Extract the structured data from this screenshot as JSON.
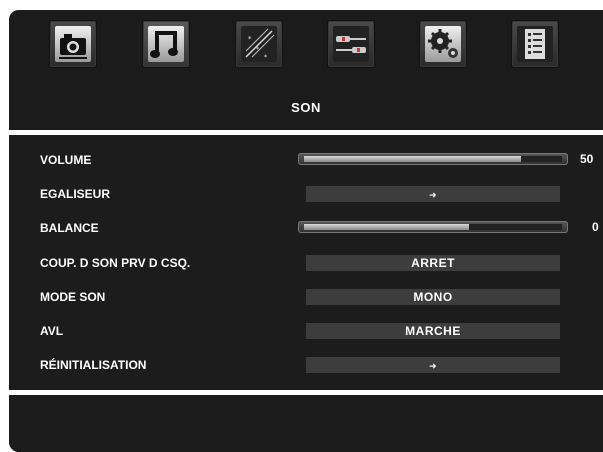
{
  "header": {
    "title": "SON",
    "icons": [
      {
        "name": "camera-icon",
        "active": false
      },
      {
        "name": "music-icon",
        "active": true
      },
      {
        "name": "stars-wand-icon",
        "active": false
      },
      {
        "name": "cable-connector-icon",
        "active": false
      },
      {
        "name": "gears-icon",
        "active": false
      },
      {
        "name": "document-icon",
        "active": false
      }
    ]
  },
  "menu": {
    "items": [
      {
        "label": "VOLUME",
        "type": "slider",
        "value": "50",
        "level": 0.84
      },
      {
        "label": "EGALISEUR",
        "type": "arrow",
        "value": "➜"
      },
      {
        "label": "BALANCE",
        "type": "slider",
        "value": "0",
        "level": 0.64
      },
      {
        "label": "COUP. D SON PRV D CSQ.",
        "type": "option",
        "value": "ARRET"
      },
      {
        "label": "MODE SON",
        "type": "option",
        "value": "MONO"
      },
      {
        "label": "AVL",
        "type": "option",
        "value": "MARCHE"
      },
      {
        "label": "RÉINITIALISATION",
        "type": "arrow",
        "value": "➜"
      }
    ]
  },
  "colors": {
    "background": "#1c1c1c",
    "value_box": "#3d3d3d",
    "separator": "#ffffff",
    "text": "#ffffff"
  }
}
